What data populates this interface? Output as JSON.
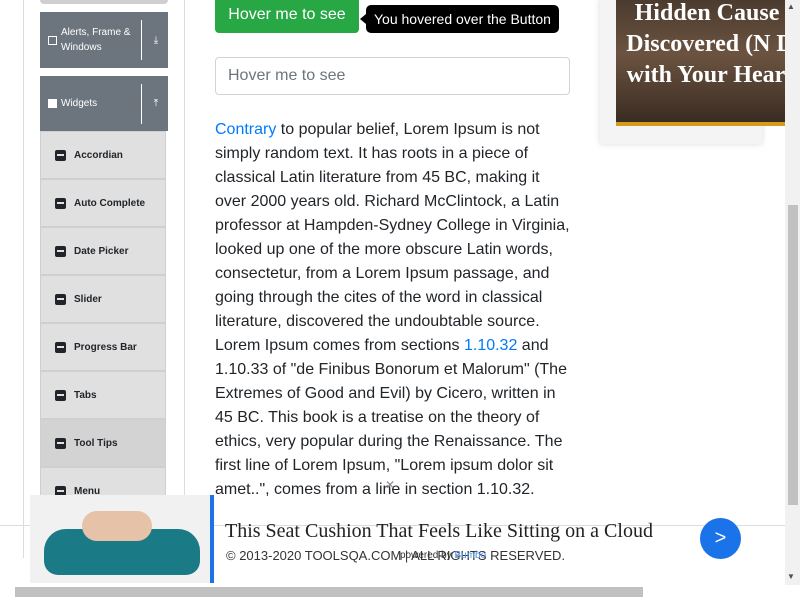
{
  "sidebar": {
    "groups": [
      {
        "label": "Alerts, Frame & Windows",
        "arrow": "⤓"
      },
      {
        "label": "Widgets",
        "arrow": "⤒"
      }
    ],
    "items": [
      {
        "label": "Accordian"
      },
      {
        "label": "Auto Complete"
      },
      {
        "label": "Date Picker"
      },
      {
        "label": "Slider"
      },
      {
        "label": "Progress Bar"
      },
      {
        "label": "Tabs"
      },
      {
        "label": "Tool Tips"
      },
      {
        "label": "Menu"
      }
    ]
  },
  "main": {
    "button_label": "Hover me to see",
    "tooltip_text": "You hovered over the Button",
    "input_placeholder": "Hover me to see",
    "link_contrary": "Contrary",
    "text_part1": " to popular belief, Lorem Ipsum is not simply random text. It has roots in a piece of classical Latin literature from 45 BC, making it over 2000 years old. Richard McClintock, a Latin professor at Hampden-Sydney College in Virginia, looked up one of the more obscure Latin words, consectetur, from a Lorem Ipsum passage, and going through the cites of the word in classical literature, discovered the undoubtable source. Lorem Ipsum comes from sections ",
    "link_section": "1.10.32",
    "text_part2": " and 1.10.33 of \"de Finibus Bonorum et Malorum\" (The Extremes of Good and Evil) by Cicero, written in 45 BC. This book is a treatise on the theory of ethics, very popular during the Renaissance. The first line of Lorem Ipsum, \"Lorem ipsum dolor sit amet..\", comes from a line in section 1.10.32."
  },
  "ad_right": {
    "text": "Hidden Cause o Discovered (N Do with Your Hearin"
  },
  "ad_bottom": {
    "title": "This Seat Cushion That Feels Like Sitting on a Cloud",
    "button": ">",
    "close": "✕"
  },
  "footer": {
    "text": "© 2013-2020 TOOLSQA.COM | ALL RIGHTS RESERVED.",
    "powered_prefix": "powered by ",
    "powered_brand": "Bumbo"
  },
  "colors": {
    "primary_green": "#28a745",
    "sidebar_header": "#6c757d",
    "link": "#007bff",
    "ad_button": "#1a73e8"
  }
}
